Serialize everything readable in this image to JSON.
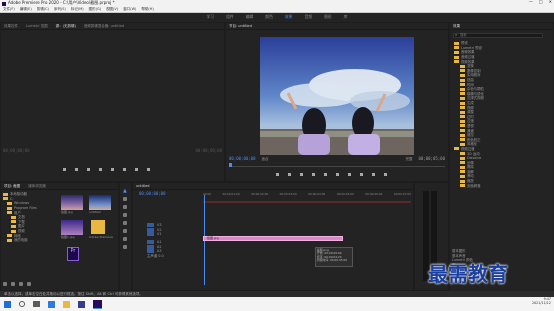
{
  "window": {
    "title": "Adobe Premiere Pro 2020 - C:\\用户\\Video\\截图.prproj *",
    "controls": [
      "—",
      "□",
      "✕"
    ]
  },
  "menu": [
    "文件(F)",
    "编辑(E)",
    "剪辑(C)",
    "序列(S)",
    "标记(M)",
    "图形(G)",
    "视图(V)",
    "窗口(W)",
    "帮助(H)"
  ],
  "workspaces": [
    "学习",
    "组件",
    "编辑",
    "颜色",
    "效果",
    "音频",
    "图形",
    "库"
  ],
  "active_workspace": "效果",
  "source": {
    "tabs": [
      "效果控件",
      "Lumetri 范围",
      "源：(无剪辑)",
      "音频剪辑混合器: untitled"
    ],
    "timecode_left": "00;00;00;00",
    "timecode_right": "00;00;00;00"
  },
  "program": {
    "tab": "节目: untitled",
    "timecode": "00;00;00;00",
    "fit": "适合",
    "quality": "完整",
    "duration": "00;00;05;00"
  },
  "project": {
    "tabs": [
      "项目: 截图",
      "媒体浏览器"
    ],
    "items": [
      {
        "name": "截图.jpg"
      },
      {
        "name": "untitled"
      },
      {
        "name": "截图1.jpg"
      },
      {
        "name": "Adobe Premiere"
      }
    ],
    "tree": [
      "本地驱动器",
      "C:",
      "Windows",
      "Program Files",
      "用户",
      "文档",
      "下载",
      "图片",
      "视频",
      "网络",
      "我的电脑"
    ]
  },
  "timeline": {
    "tab": "untitled",
    "timecode": "00;00;00;00",
    "ruler": [
      "00;00",
      "00;00;01;00",
      "00;00;02;00",
      "00;00;03;00",
      "00;00;04;00",
      "00;00;05;00",
      "00;00;06;00",
      "00;00;07;00"
    ],
    "tracks": [
      "V3",
      "V2",
      "V1",
      "A1",
      "A2",
      "A3"
    ],
    "master": "主声道",
    "master_value": "0.0",
    "clip": "截图.jpg",
    "tooltip": [
      "截图.png",
      "开始: 00;00;00;00",
      "结束: 00;00;04;29",
      "持续时间: 00;00;05;00"
    ]
  },
  "effects": {
    "tab": "效果",
    "search_placeholder": "搜索",
    "tree": [
      "预设",
      "Lumetri 预设",
      "音频效果",
      "音频过渡",
      "视频效果",
      "变换",
      "图像控制",
      "实用程序",
      "扭曲",
      "时间",
      "杂色与颗粒",
      "模糊与锐化",
      "沉浸式视频",
      "生成",
      "视频",
      "调整",
      "过时",
      "过渡",
      "透视",
      "通道",
      "键控",
      "颜色校正",
      "风格化",
      "视频过渡",
      "3D 运动",
      "Dissolve",
      "划像",
      "擦除",
      "溶解",
      "滑动",
      "缩放",
      "页面剥落"
    ],
    "bottom": [
      "基本图形",
      "基本声音",
      "Lumetri 颜色",
      "库",
      "标记",
      "历史记录",
      "信息"
    ]
  },
  "status": {
    "text": "单击以选择，或单击空白处并拖动以进行框选。按住 Shift、Alt 和 Ctrl 可获得其他选项。"
  },
  "watermark": "最需教育",
  "taskbar": {
    "time": "9:47",
    "date": "2021/11/12"
  }
}
